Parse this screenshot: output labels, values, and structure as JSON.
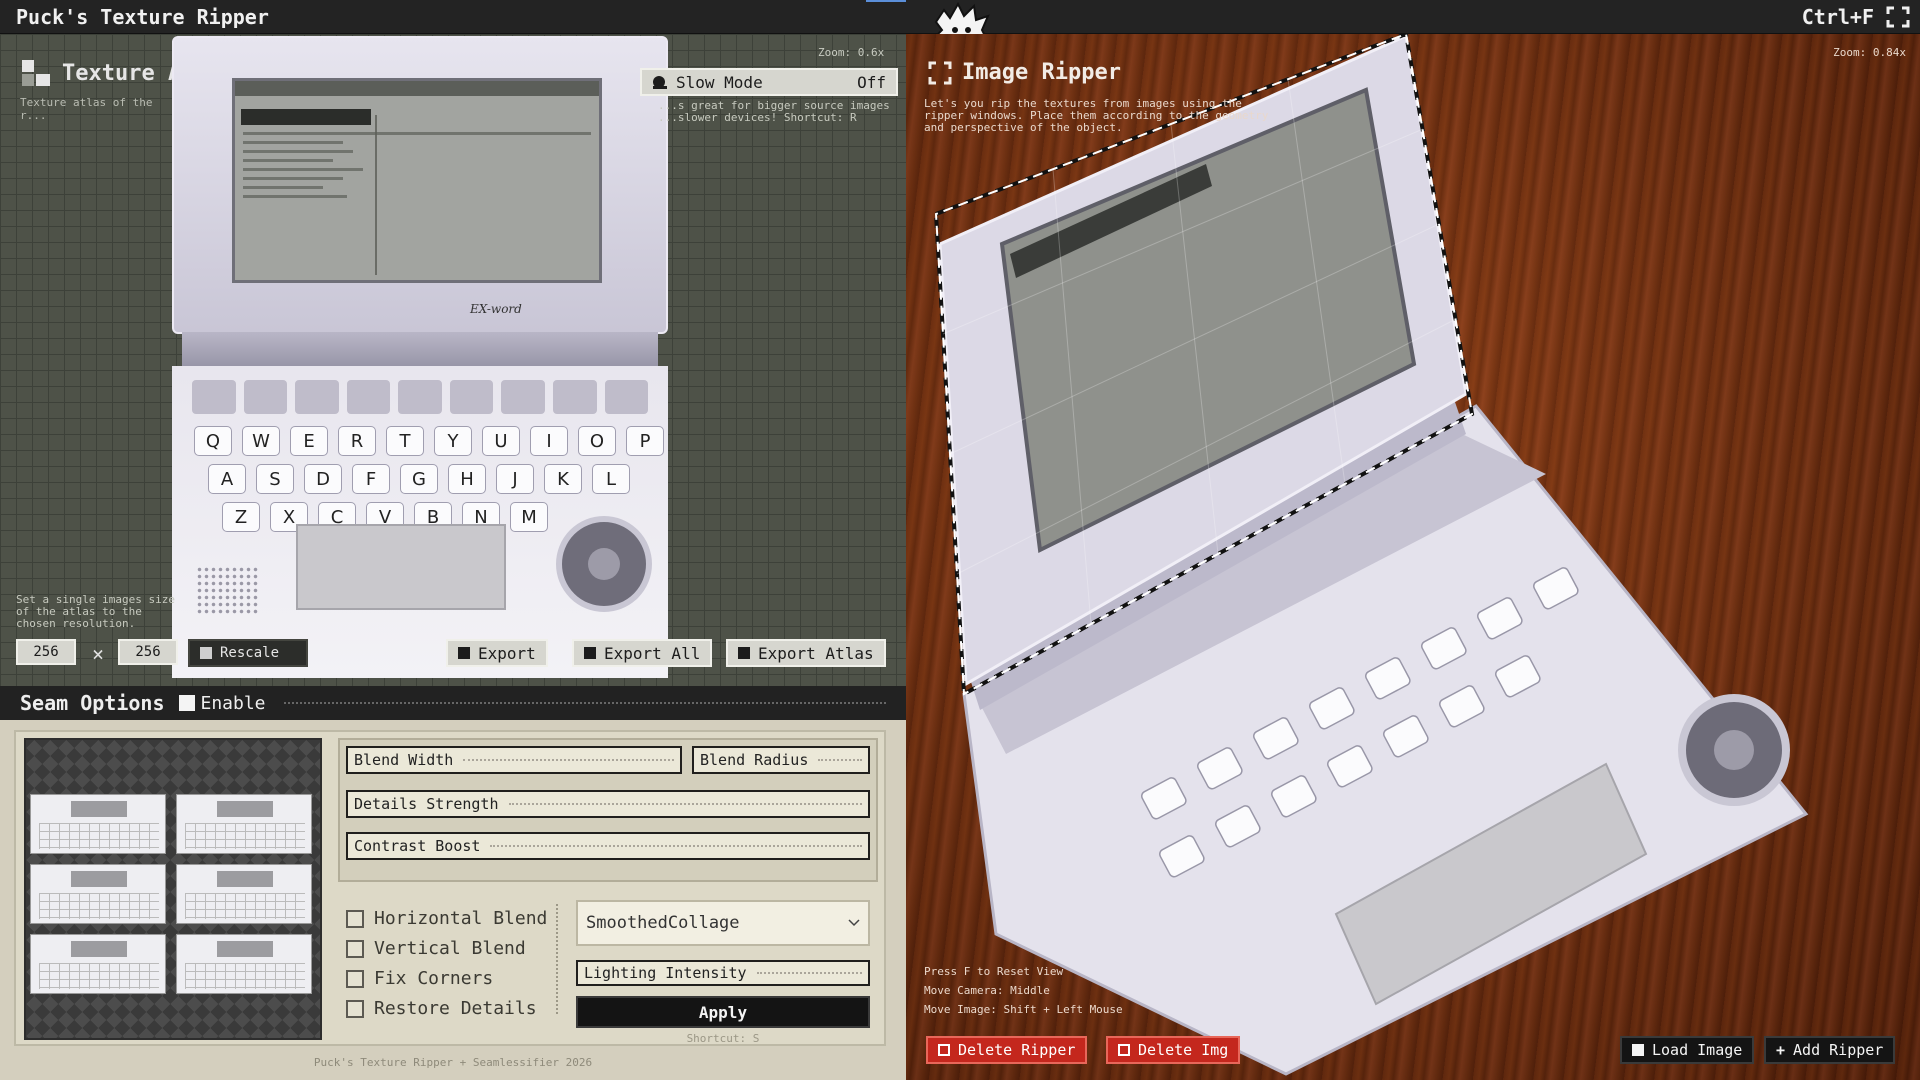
{
  "titlebar": {
    "title": "Puck's Texture Ripper",
    "shortcut": "Ctrl+F"
  },
  "atlas": {
    "title": "Texture Atlas",
    "description": "Texture atlas of the r...",
    "zoom": "Zoom: 0.6x",
    "slow_mode": {
      "label": "Slow Mode",
      "value": "Off",
      "hint": "...s great for bigger source images ...slower devices! Shortcut: R"
    },
    "size_hint": "Set a single images size of the atlas to the chosen resolution.",
    "width": "256",
    "height": "256",
    "size_sep": "×",
    "rescale_label": "Rescale",
    "export_label": "Export",
    "export_all_label": "Export All",
    "export_atlas_label": "Export Atlas"
  },
  "device": {
    "brand": "EX-word",
    "keys_row1": [
      "Q",
      "W",
      "E",
      "R",
      "T",
      "Y",
      "U",
      "I",
      "O",
      "P"
    ],
    "keys_row2": [
      "A",
      "S",
      "D",
      "F",
      "G",
      "H",
      "J",
      "K",
      "L"
    ],
    "keys_row3": [
      "Z",
      "X",
      "C",
      "V",
      "B",
      "N",
      "M"
    ]
  },
  "seam": {
    "title": "Seam Options",
    "enable_label": "Enable",
    "blend_width": "Blend Width",
    "blend_radius": "Blend Radius",
    "details_strength": "Details Strength",
    "contrast_boost": "Contrast Boost",
    "horizontal_blend": "Horizontal Blend",
    "vertical_blend": "Vertical Blend",
    "fix_corners": "Fix Corners",
    "restore_details": "Restore Details",
    "blend_mode": "SmoothedCollage",
    "lighting_intensity": "Lighting Intensity",
    "apply_label": "Apply",
    "apply_shortcut": "Shortcut: S"
  },
  "footer": "Puck's Texture Ripper + Seamlessifier 2026",
  "ripper": {
    "title": "Image Ripper",
    "description": "Let's you rip the textures from images using the ripper windows. Place them according to the geometry and perspective of the object.",
    "zoom": "Zoom: 0.84x",
    "help": [
      "Press F to Reset View",
      "Move Camera: Middle",
      "Move Image: Shift + Left Mouse"
    ],
    "delete_ripper_label": "Delete Ripper",
    "delete_img_label": "Delete Img",
    "load_image_label": "Load Image",
    "add_ripper_label": "Add Ripper"
  },
  "colors": {
    "accent_red": "#c4271d",
    "panel_cream": "#ddd9c7",
    "grid_bg": "#4e5248",
    "apply_black": "#141414"
  }
}
